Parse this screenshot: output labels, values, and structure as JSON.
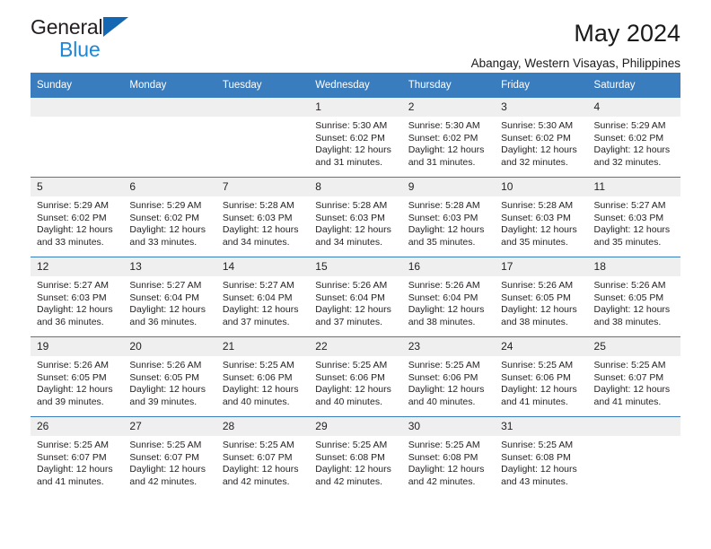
{
  "brand": {
    "name_part1": "General",
    "name_part2": "Blue",
    "logo_icon": "triangle-flag-icon"
  },
  "header": {
    "month_title": "May 2024",
    "location": "Abangay, Western Visayas, Philippines"
  },
  "theme": {
    "header_blue": "#3a7dbf",
    "brand_blue": "#1d87d8",
    "logo_blue": "#1468b3",
    "daynum_band": "#efefef",
    "text": "#231f20"
  },
  "calendar": {
    "weekday_headers": [
      "Sunday",
      "Monday",
      "Tuesday",
      "Wednesday",
      "Thursday",
      "Friday",
      "Saturday"
    ],
    "weeks": [
      [
        {
          "day": "",
          "lines": []
        },
        {
          "day": "",
          "lines": []
        },
        {
          "day": "",
          "lines": []
        },
        {
          "day": "1",
          "lines": [
            "Sunrise: 5:30 AM",
            "Sunset: 6:02 PM",
            "Daylight: 12 hours",
            "and 31 minutes."
          ]
        },
        {
          "day": "2",
          "lines": [
            "Sunrise: 5:30 AM",
            "Sunset: 6:02 PM",
            "Daylight: 12 hours",
            "and 31 minutes."
          ]
        },
        {
          "day": "3",
          "lines": [
            "Sunrise: 5:30 AM",
            "Sunset: 6:02 PM",
            "Daylight: 12 hours",
            "and 32 minutes."
          ]
        },
        {
          "day": "4",
          "lines": [
            "Sunrise: 5:29 AM",
            "Sunset: 6:02 PM",
            "Daylight: 12 hours",
            "and 32 minutes."
          ]
        }
      ],
      [
        {
          "day": "5",
          "lines": [
            "Sunrise: 5:29 AM",
            "Sunset: 6:02 PM",
            "Daylight: 12 hours",
            "and 33 minutes."
          ]
        },
        {
          "day": "6",
          "lines": [
            "Sunrise: 5:29 AM",
            "Sunset: 6:02 PM",
            "Daylight: 12 hours",
            "and 33 minutes."
          ]
        },
        {
          "day": "7",
          "lines": [
            "Sunrise: 5:28 AM",
            "Sunset: 6:03 PM",
            "Daylight: 12 hours",
            "and 34 minutes."
          ]
        },
        {
          "day": "8",
          "lines": [
            "Sunrise: 5:28 AM",
            "Sunset: 6:03 PM",
            "Daylight: 12 hours",
            "and 34 minutes."
          ]
        },
        {
          "day": "9",
          "lines": [
            "Sunrise: 5:28 AM",
            "Sunset: 6:03 PM",
            "Daylight: 12 hours",
            "and 35 minutes."
          ]
        },
        {
          "day": "10",
          "lines": [
            "Sunrise: 5:28 AM",
            "Sunset: 6:03 PM",
            "Daylight: 12 hours",
            "and 35 minutes."
          ]
        },
        {
          "day": "11",
          "lines": [
            "Sunrise: 5:27 AM",
            "Sunset: 6:03 PM",
            "Daylight: 12 hours",
            "and 35 minutes."
          ]
        }
      ],
      [
        {
          "day": "12",
          "lines": [
            "Sunrise: 5:27 AM",
            "Sunset: 6:03 PM",
            "Daylight: 12 hours",
            "and 36 minutes."
          ]
        },
        {
          "day": "13",
          "lines": [
            "Sunrise: 5:27 AM",
            "Sunset: 6:04 PM",
            "Daylight: 12 hours",
            "and 36 minutes."
          ]
        },
        {
          "day": "14",
          "lines": [
            "Sunrise: 5:27 AM",
            "Sunset: 6:04 PM",
            "Daylight: 12 hours",
            "and 37 minutes."
          ]
        },
        {
          "day": "15",
          "lines": [
            "Sunrise: 5:26 AM",
            "Sunset: 6:04 PM",
            "Daylight: 12 hours",
            "and 37 minutes."
          ]
        },
        {
          "day": "16",
          "lines": [
            "Sunrise: 5:26 AM",
            "Sunset: 6:04 PM",
            "Daylight: 12 hours",
            "and 38 minutes."
          ]
        },
        {
          "day": "17",
          "lines": [
            "Sunrise: 5:26 AM",
            "Sunset: 6:05 PM",
            "Daylight: 12 hours",
            "and 38 minutes."
          ]
        },
        {
          "day": "18",
          "lines": [
            "Sunrise: 5:26 AM",
            "Sunset: 6:05 PM",
            "Daylight: 12 hours",
            "and 38 minutes."
          ]
        }
      ],
      [
        {
          "day": "19",
          "lines": [
            "Sunrise: 5:26 AM",
            "Sunset: 6:05 PM",
            "Daylight: 12 hours",
            "and 39 minutes."
          ]
        },
        {
          "day": "20",
          "lines": [
            "Sunrise: 5:26 AM",
            "Sunset: 6:05 PM",
            "Daylight: 12 hours",
            "and 39 minutes."
          ]
        },
        {
          "day": "21",
          "lines": [
            "Sunrise: 5:25 AM",
            "Sunset: 6:06 PM",
            "Daylight: 12 hours",
            "and 40 minutes."
          ]
        },
        {
          "day": "22",
          "lines": [
            "Sunrise: 5:25 AM",
            "Sunset: 6:06 PM",
            "Daylight: 12 hours",
            "and 40 minutes."
          ]
        },
        {
          "day": "23",
          "lines": [
            "Sunrise: 5:25 AM",
            "Sunset: 6:06 PM",
            "Daylight: 12 hours",
            "and 40 minutes."
          ]
        },
        {
          "day": "24",
          "lines": [
            "Sunrise: 5:25 AM",
            "Sunset: 6:06 PM",
            "Daylight: 12 hours",
            "and 41 minutes."
          ]
        },
        {
          "day": "25",
          "lines": [
            "Sunrise: 5:25 AM",
            "Sunset: 6:07 PM",
            "Daylight: 12 hours",
            "and 41 minutes."
          ]
        }
      ],
      [
        {
          "day": "26",
          "lines": [
            "Sunrise: 5:25 AM",
            "Sunset: 6:07 PM",
            "Daylight: 12 hours",
            "and 41 minutes."
          ]
        },
        {
          "day": "27",
          "lines": [
            "Sunrise: 5:25 AM",
            "Sunset: 6:07 PM",
            "Daylight: 12 hours",
            "and 42 minutes."
          ]
        },
        {
          "day": "28",
          "lines": [
            "Sunrise: 5:25 AM",
            "Sunset: 6:07 PM",
            "Daylight: 12 hours",
            "and 42 minutes."
          ]
        },
        {
          "day": "29",
          "lines": [
            "Sunrise: 5:25 AM",
            "Sunset: 6:08 PM",
            "Daylight: 12 hours",
            "and 42 minutes."
          ]
        },
        {
          "day": "30",
          "lines": [
            "Sunrise: 5:25 AM",
            "Sunset: 6:08 PM",
            "Daylight: 12 hours",
            "and 42 minutes."
          ]
        },
        {
          "day": "31",
          "lines": [
            "Sunrise: 5:25 AM",
            "Sunset: 6:08 PM",
            "Daylight: 12 hours",
            "and 43 minutes."
          ]
        },
        {
          "day": "",
          "lines": []
        }
      ]
    ]
  }
}
